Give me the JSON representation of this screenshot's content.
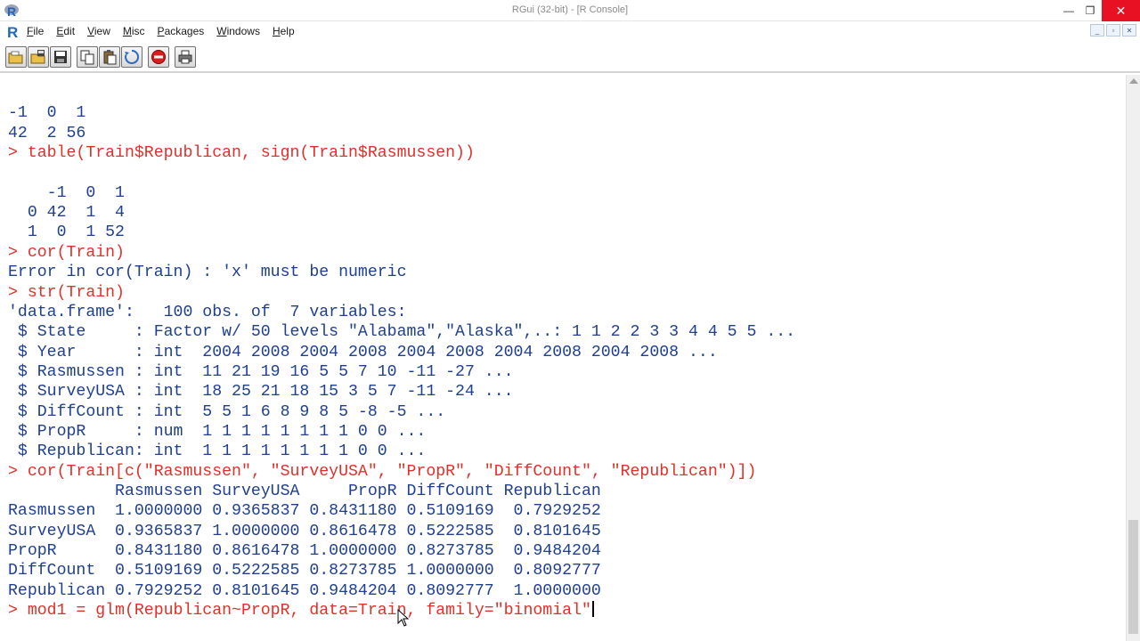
{
  "window": {
    "title": "RGui (32-bit) - [R Console]",
    "minimize_glyph": "—",
    "maximize_glyph": "❐",
    "close_glyph": "✕"
  },
  "menu": {
    "items": [
      "File",
      "Edit",
      "View",
      "Misc",
      "Packages",
      "Windows",
      "Help"
    ]
  },
  "mdi_controls": [
    "_",
    "▫",
    "✕"
  ],
  "toolbar": {
    "buttons": [
      {
        "name": "open-script-icon"
      },
      {
        "name": "load-workspace-icon"
      },
      {
        "name": "save-workspace-icon"
      },
      {
        "name": "copy-icon"
      },
      {
        "name": "paste-icon"
      },
      {
        "name": "copy-paste-icon"
      },
      {
        "name": "stop-icon"
      },
      {
        "name": "print-icon"
      }
    ]
  },
  "colors": {
    "output": "#1f3f8f",
    "command": "#e0302a",
    "close_button": "#e81123"
  },
  "console": {
    "lines": [
      {
        "type": "out",
        "text": ""
      },
      {
        "type": "out",
        "text": "-1  0  1"
      },
      {
        "type": "out",
        "text": "42  2 56"
      },
      {
        "type": "cmd",
        "text": "> table(Train$Republican, sign(Train$Rasmussen))"
      },
      {
        "type": "out",
        "text": ""
      },
      {
        "type": "out",
        "text": "    -1  0  1"
      },
      {
        "type": "out",
        "text": "  0 42  1  4"
      },
      {
        "type": "out",
        "text": "  1  0  1 52"
      },
      {
        "type": "cmd",
        "text": "> cor(Train)"
      },
      {
        "type": "out",
        "text": "Error in cor(Train) : 'x' must be numeric"
      },
      {
        "type": "cmd",
        "text": "> str(Train)"
      },
      {
        "type": "out",
        "text": "'data.frame':   100 obs. of  7 variables:"
      },
      {
        "type": "out",
        "text": " $ State     : Factor w/ 50 levels \"Alabama\",\"Alaska\",..: 1 1 2 2 3 3 4 4 5 5 ..."
      },
      {
        "type": "out",
        "text": " $ Year      : int  2004 2008 2004 2008 2004 2008 2004 2008 2004 2008 ..."
      },
      {
        "type": "out",
        "text": " $ Rasmussen : int  11 21 19 16 5 5 7 10 -11 -27 ..."
      },
      {
        "type": "out",
        "text": " $ SurveyUSA : int  18 25 21 18 15 3 5 7 -11 -24 ..."
      },
      {
        "type": "out",
        "text": " $ DiffCount : int  5 5 1 6 8 9 8 5 -8 -5 ..."
      },
      {
        "type": "out",
        "text": " $ PropR     : num  1 1 1 1 1 1 1 1 0 0 ..."
      },
      {
        "type": "out",
        "text": " $ Republican: int  1 1 1 1 1 1 1 1 0 0 ..."
      },
      {
        "type": "cmd",
        "text": "> cor(Train[c(\"Rasmussen\", \"SurveyUSA\", \"PropR\", \"DiffCount\", \"Republican\")])"
      },
      {
        "type": "out",
        "text": "           Rasmussen SurveyUSA     PropR DiffCount Republican"
      },
      {
        "type": "out",
        "text": "Rasmussen  1.0000000 0.9365837 0.8431180 0.5109169  0.7929252"
      },
      {
        "type": "out",
        "text": "SurveyUSA  0.9365837 1.0000000 0.8616478 0.5222585  0.8101645"
      },
      {
        "type": "out",
        "text": "PropR      0.8431180 0.8616478 1.0000000 0.8273785  0.9484204"
      },
      {
        "type": "out",
        "text": "DiffCount  0.5109169 0.5222585 0.8273785 1.0000000  0.8092777"
      },
      {
        "type": "out",
        "text": "Republican 0.7929252 0.8101645 0.9484204 0.8092777  1.0000000"
      },
      {
        "type": "cmd",
        "text": "> mod1 = glm(Republican~PropR, data=Train, family=\"binomial\"",
        "caret": true
      }
    ]
  }
}
